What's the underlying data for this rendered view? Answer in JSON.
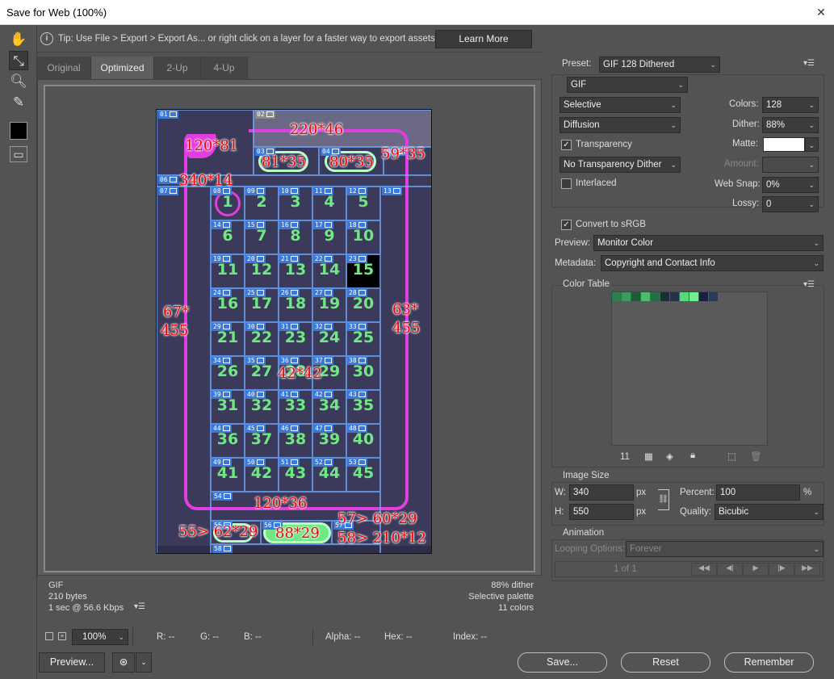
{
  "window": {
    "title": "Save for Web (100%)",
    "close": "✕"
  },
  "tip": {
    "text": "Tip: Use File > Export > Export As...  or right click on a layer for a faster way to export assets",
    "learn_more": "Learn More"
  },
  "tabs": [
    {
      "label": "Original"
    },
    {
      "label": "Optimized"
    },
    {
      "label": "2-Up"
    },
    {
      "label": "4-Up"
    }
  ],
  "image": {
    "slice_badges": [
      "01",
      "02",
      "03",
      "04",
      "05",
      "06",
      "07",
      "08",
      "09",
      "10",
      "11",
      "12",
      "13",
      "14",
      "15",
      "16",
      "17",
      "18",
      "19",
      "20",
      "21",
      "22",
      "23",
      "24",
      "25",
      "26",
      "27",
      "28",
      "29",
      "30",
      "31",
      "32",
      "33",
      "34",
      "35",
      "36",
      "37",
      "38",
      "39",
      "40",
      "41",
      "42",
      "43",
      "44",
      "45",
      "46",
      "47",
      "48",
      "49",
      "50",
      "51",
      "52",
      "53",
      "54",
      "55",
      "56",
      "57",
      "58"
    ],
    "numbers": [
      "1",
      "2",
      "3",
      "4",
      "5",
      "6",
      "7",
      "8",
      "9",
      "10",
      "11",
      "12",
      "13",
      "14",
      "15",
      "16",
      "17",
      "18",
      "19",
      "20",
      "21",
      "22",
      "23",
      "24",
      "25",
      "26",
      "27",
      "28",
      "29",
      "30",
      "31",
      "32",
      "33",
      "34",
      "35",
      "36",
      "37",
      "38",
      "39",
      "40",
      "41",
      "42",
      "43",
      "44",
      "45"
    ],
    "annotations": {
      "a1": "220*46",
      "a2": "120*81",
      "a3": "81*35",
      "a4": "80*35",
      "a5": "59*35",
      "a6": "340*14",
      "a7": "67*",
      "a7b": "455",
      "a8": "63*",
      "a8b": "455",
      "a9": "42*42",
      "a10": "120*36",
      "a11": "55> 62*29",
      "a12": "88*29",
      "a13": "57> 60*29",
      "a14": "58> 210*12"
    }
  },
  "status": {
    "format": "GIF",
    "size": "210 bytes",
    "speed": "1 sec @ 56.6 Kbps",
    "dither": "88% dither",
    "palette": "Selective palette",
    "colors": "11 colors"
  },
  "zoom": {
    "value": "100%",
    "r": "R: --",
    "g": "G: --",
    "b": "B: --",
    "alpha": "Alpha: --",
    "hex": "Hex: --",
    "index": "Index: --"
  },
  "buttons": {
    "preview": "Preview...",
    "save": "Save...",
    "reset": "Reset",
    "remember": "Remember"
  },
  "settings": {
    "preset_label": "Preset:",
    "preset": "GIF 128 Dithered",
    "format": "GIF",
    "reduction": "Selective",
    "dither_algo": "Diffusion",
    "transparency": "Transparency",
    "transparency_dither": "No Transparency Dither",
    "interlaced": "Interlaced",
    "colors_label": "Colors:",
    "colors": "128",
    "dither_label": "Dither:",
    "dither": "88%",
    "matte_label": "Matte:",
    "amount_label": "Amount:",
    "websnap_label": "Web Snap:",
    "websnap": "0%",
    "lossy_label": "Lossy:",
    "lossy": "0",
    "convert_srgb": "Convert to sRGB",
    "preview_label": "Preview:",
    "preview": "Monitor Color",
    "metadata_label": "Metadata:",
    "metadata": "Copyright and Contact Info"
  },
  "color_table": {
    "title": "Color Table",
    "count": "11",
    "swatches": [
      "#2e7d4f",
      "#3a9a60",
      "#1f5a3a",
      "#4bbd6f",
      "#2a6b45",
      "#1d2b3a",
      "#223344",
      "#5ad67e",
      "#6ff08c",
      "#1a1f3a",
      "#2b3a5a"
    ]
  },
  "image_size": {
    "title": "Image Size",
    "w_label": "W:",
    "w": "340",
    "h_label": "H:",
    "h": "550",
    "px": "px",
    "percent_label": "Percent:",
    "percent": "100",
    "pct": "%",
    "quality_label": "Quality:",
    "quality": "Bicubic"
  },
  "animation": {
    "title": "Animation",
    "looping_label": "Looping Options:",
    "looping": "Forever",
    "frame": "1 of 1"
  }
}
